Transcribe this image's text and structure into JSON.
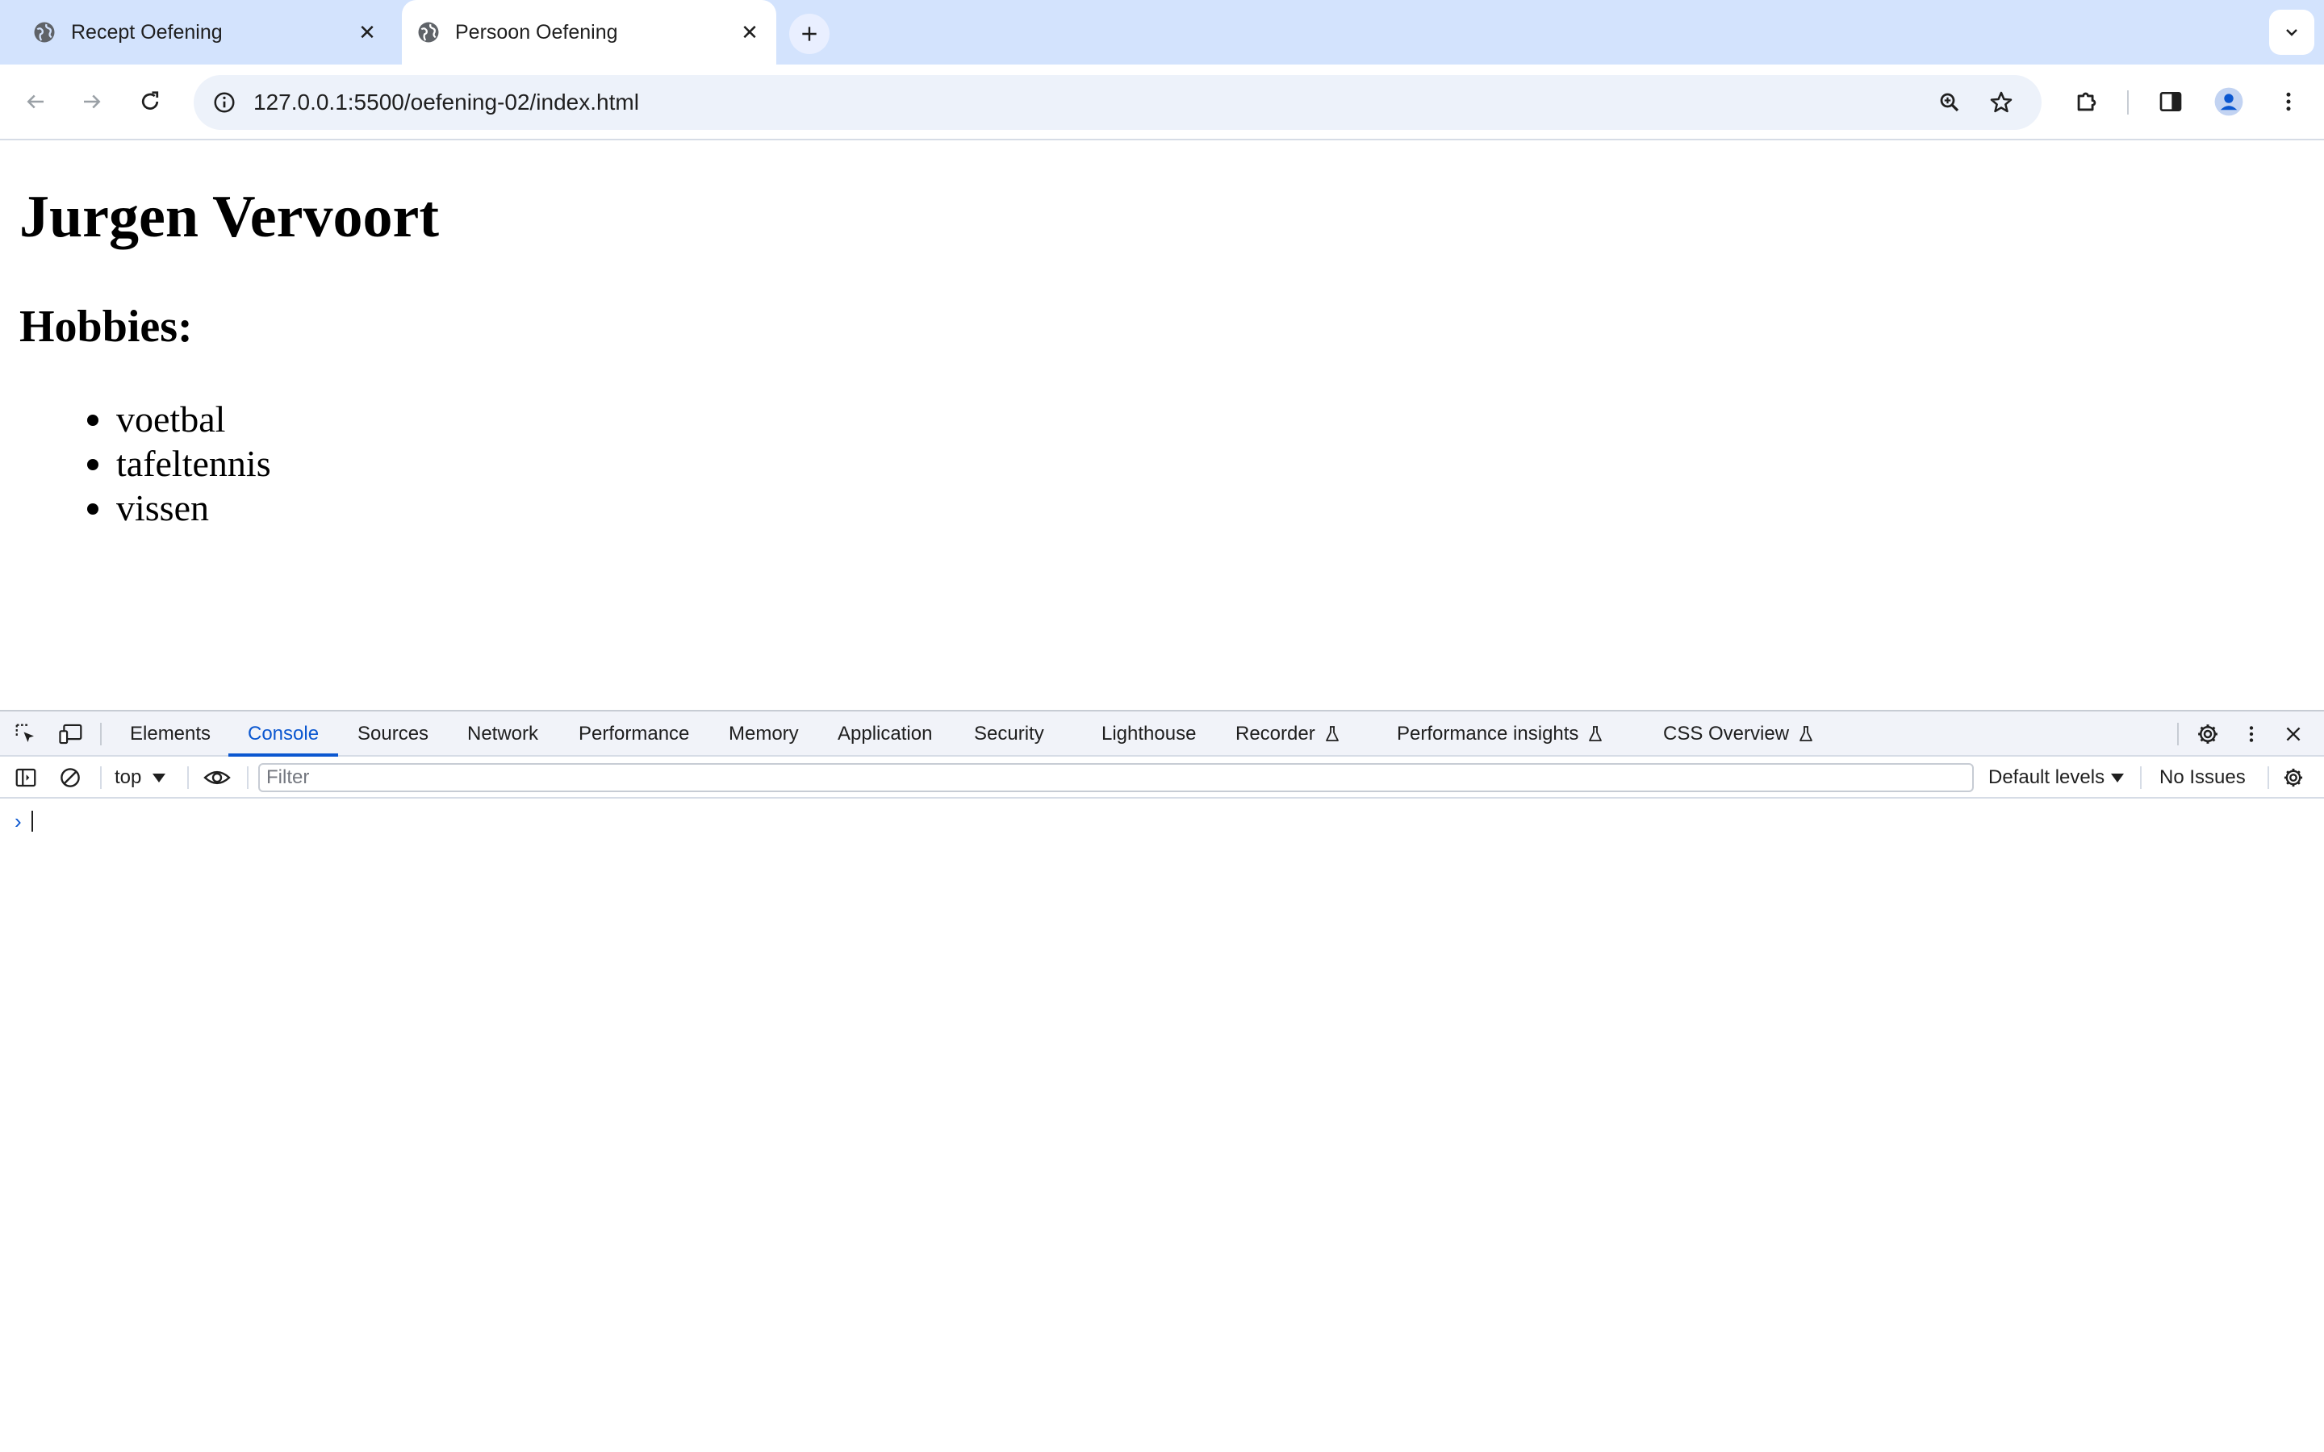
{
  "browser": {
    "tabs": [
      {
        "title": "Recept Oefening",
        "favicon": "globe-icon",
        "active": false
      },
      {
        "title": "Persoon Oefening",
        "favicon": "globe-icon",
        "active": true
      }
    ],
    "url": "127.0.0.1:5500/oefening-02/index.html"
  },
  "page": {
    "heading": "Jurgen Vervoort",
    "subheading": "Hobbies:",
    "hobbies": [
      "voetbal",
      "tafeltennis",
      "vissen"
    ]
  },
  "devtools": {
    "tabs": [
      {
        "label": "Elements"
      },
      {
        "label": "Console",
        "active": true
      },
      {
        "label": "Sources"
      },
      {
        "label": "Network"
      },
      {
        "label": "Performance"
      },
      {
        "label": "Memory"
      },
      {
        "label": "Application"
      },
      {
        "label": "Security"
      },
      {
        "label": "Lighthouse"
      },
      {
        "label": "Recorder",
        "experimental": true
      },
      {
        "label": "Performance insights",
        "experimental": true
      },
      {
        "label": "CSS Overview",
        "experimental": true
      }
    ],
    "console": {
      "context": "top",
      "filter_placeholder": "Filter",
      "filter_value": "",
      "levels": "Default levels",
      "issues": "No Issues"
    }
  },
  "colors": {
    "tabstrip": "#d3e3fd",
    "accent": "#0b57d0",
    "omnibox": "#edf2fa",
    "devtools_header": "#f1f3f9"
  }
}
